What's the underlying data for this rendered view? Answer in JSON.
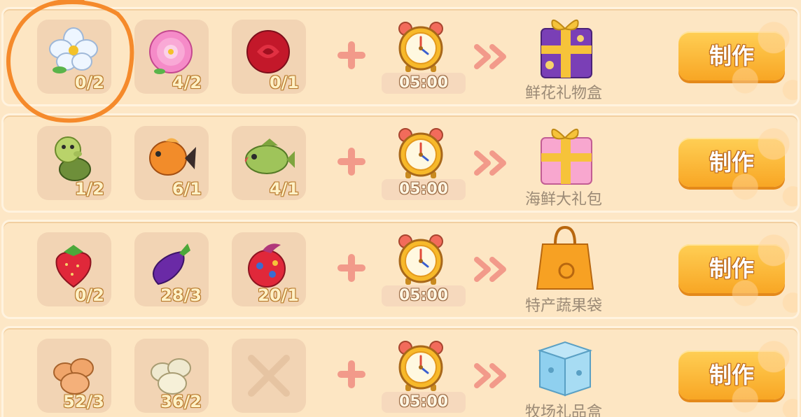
{
  "colors": {
    "background": "#fde7c6",
    "button_gradient_top": "#ffcf55",
    "button_gradient_bottom": "#f8a624",
    "annotation_circle": "#f58a2b",
    "plus_and_arrows": "#f29a8a"
  },
  "recipes": [
    {
      "ingredients": [
        {
          "icon": "white-flower-icon",
          "count": "0/2"
        },
        {
          "icon": "pink-peony-icon",
          "count": "4/2"
        },
        {
          "icon": "red-rose-icon",
          "count": "0/1"
        }
      ],
      "timer": "05:00",
      "product_icon": "purple-gift-box-icon",
      "product_name": "鲜花礼物盒",
      "button_label": "制作"
    },
    {
      "ingredients": [
        {
          "icon": "green-turtle-icon",
          "count": "1/2"
        },
        {
          "icon": "orange-fish-icon",
          "count": "6/1"
        },
        {
          "icon": "green-bass-fish-icon",
          "count": "4/1"
        }
      ],
      "timer": "05:00",
      "product_icon": "pink-gift-box-icon",
      "product_name": "海鲜大礼包",
      "button_label": "制作"
    },
    {
      "ingredients": [
        {
          "icon": "strawberry-icon",
          "count": "0/2"
        },
        {
          "icon": "eggplant-icon",
          "count": "28/3"
        },
        {
          "icon": "dragon-fruit-icon",
          "count": "20/1"
        }
      ],
      "timer": "05:00",
      "product_icon": "orange-shopping-bag-icon",
      "product_name": "特产蔬果袋",
      "button_label": "制作"
    },
    {
      "ingredients": [
        {
          "icon": "brown-eggs-icon",
          "count": "52/3"
        },
        {
          "icon": "white-eggs-icon",
          "count": "36/2"
        },
        {
          "icon": "empty-slot-x-icon",
          "count": ""
        }
      ],
      "timer": "05:00",
      "product_icon": "blue-gift-box-icon",
      "product_name": "牧场礼品盒",
      "button_label": "制作"
    }
  ]
}
